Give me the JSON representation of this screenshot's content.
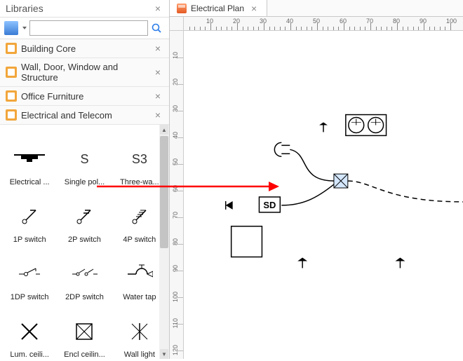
{
  "panel": {
    "title": "Libraries",
    "search_placeholder": "",
    "categories": [
      {
        "label": "Building Core"
      },
      {
        "label": "Wall, Door, Window and Structure"
      },
      {
        "label": "Office Furniture"
      },
      {
        "label": "Electrical and Telecom"
      }
    ],
    "shapes": [
      {
        "id": "electrical",
        "label": "Electrical ..."
      },
      {
        "id": "single-pole",
        "label": "Single pol...",
        "text": "S"
      },
      {
        "id": "three-way",
        "label": "Three-wa...",
        "text": "S3"
      },
      {
        "id": "1p-switch",
        "label": "1P switch"
      },
      {
        "id": "2p-switch",
        "label": "2P switch"
      },
      {
        "id": "4p-switch",
        "label": "4P switch"
      },
      {
        "id": "1dp-switch",
        "label": "1DP switch"
      },
      {
        "id": "2dp-switch",
        "label": "2DP switch"
      },
      {
        "id": "water-tap",
        "label": "Water tap"
      },
      {
        "id": "lum-ceiling",
        "label": "Lum. ceili..."
      },
      {
        "id": "encl-ceiling",
        "label": "Encl ceilin..."
      },
      {
        "id": "wall-light",
        "label": "Wall light"
      }
    ]
  },
  "tab": {
    "label": "Electrical Plan"
  },
  "ruler_h": [
    10,
    20,
    30,
    40,
    50,
    60,
    70,
    80,
    90,
    100
  ],
  "ruler_v": [
    10,
    20,
    30,
    40,
    50,
    60,
    70,
    80,
    90,
    100,
    110,
    120
  ],
  "canvas": {
    "sd_label": "SD"
  }
}
